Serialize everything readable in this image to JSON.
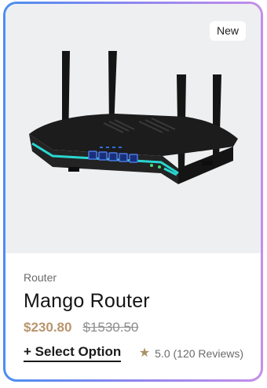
{
  "badge": {
    "label": "New"
  },
  "product": {
    "category": "Router",
    "title": "Mango Router",
    "price_sale": "$230.80",
    "price_original": "$1530.50",
    "image_icon": "router-image"
  },
  "actions": {
    "select_option": "+ Select Option"
  },
  "rating": {
    "text": "5.0 (120 Reviews)",
    "icon": "star-icon"
  },
  "colors": {
    "accent_price": "#b8956d",
    "star": "#a99065",
    "border_gradient_start": "#4a8ef0",
    "border_gradient_end": "#c48ee9",
    "router_glow": "#2ad6d0"
  }
}
